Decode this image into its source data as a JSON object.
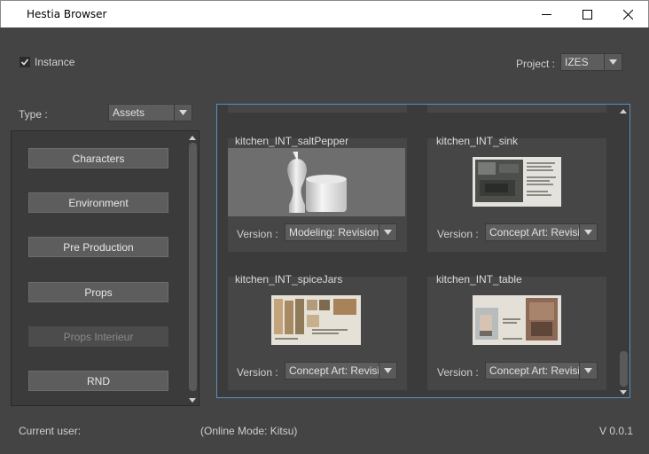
{
  "window": {
    "title": "Hestia Browser",
    "controls": [
      "minimize-icon",
      "maximize-icon",
      "close-icon"
    ]
  },
  "header": {
    "instance_label": "Instance",
    "instance_checked": true,
    "project_label": "Project :",
    "project_value": "IZES"
  },
  "type_selector": {
    "label": "Type :",
    "value": "Assets"
  },
  "categories": [
    {
      "label": "Characters",
      "enabled": true
    },
    {
      "label": "Environment",
      "enabled": true
    },
    {
      "label": "Pre Production",
      "enabled": true
    },
    {
      "label": "Props",
      "enabled": true
    },
    {
      "label": "Props Interieur",
      "enabled": false
    },
    {
      "label": "RND",
      "enabled": true
    }
  ],
  "assets": [
    {
      "name": "kitchen_INT_saltPepper",
      "version_label": "Version :",
      "version_value": "Modeling: Revision"
    },
    {
      "name": "kitchen_INT_sink",
      "version_label": "Version :",
      "version_value": "Concept Art: Revisio"
    },
    {
      "name": "kitchen_INT_spiceJars",
      "version_label": "Version :",
      "version_value": "Concept Art: Revisio"
    },
    {
      "name": "kitchen_INT_table",
      "version_label": "Version :",
      "version_value": "Concept Art: Revisio"
    }
  ],
  "footer": {
    "current_user_label": "Current user:",
    "mode": "(Online Mode: Kitsu)",
    "version": "V 0.0.1"
  },
  "colors": {
    "background": "#444444",
    "panel": "#3b3b3b",
    "button": "#5d5d5d",
    "focus_border": "#5b8fbf"
  }
}
